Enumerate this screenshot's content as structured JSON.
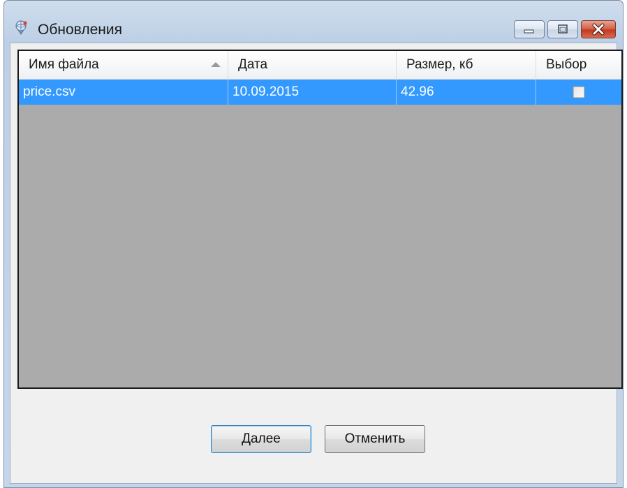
{
  "window": {
    "title": "Обновления",
    "icon": "update-globe-icon"
  },
  "caption_buttons": [
    "minimize-icon",
    "maximize-icon",
    "close-icon"
  ],
  "grid": {
    "columns": [
      "Имя файла",
      "Дата",
      "Размер, кб",
      "Выбор"
    ],
    "sort_column": "Имя файла",
    "sort_direction": "ascending",
    "rows": [
      {
        "name": "price.csv",
        "date": "10.09.2015",
        "size": "42.96",
        "selected": false
      }
    ],
    "selection_color": "#3399ff",
    "empty_area_color": "#ababab"
  },
  "buttons": {
    "next_label": "Далее",
    "cancel_label": "Отменить"
  }
}
